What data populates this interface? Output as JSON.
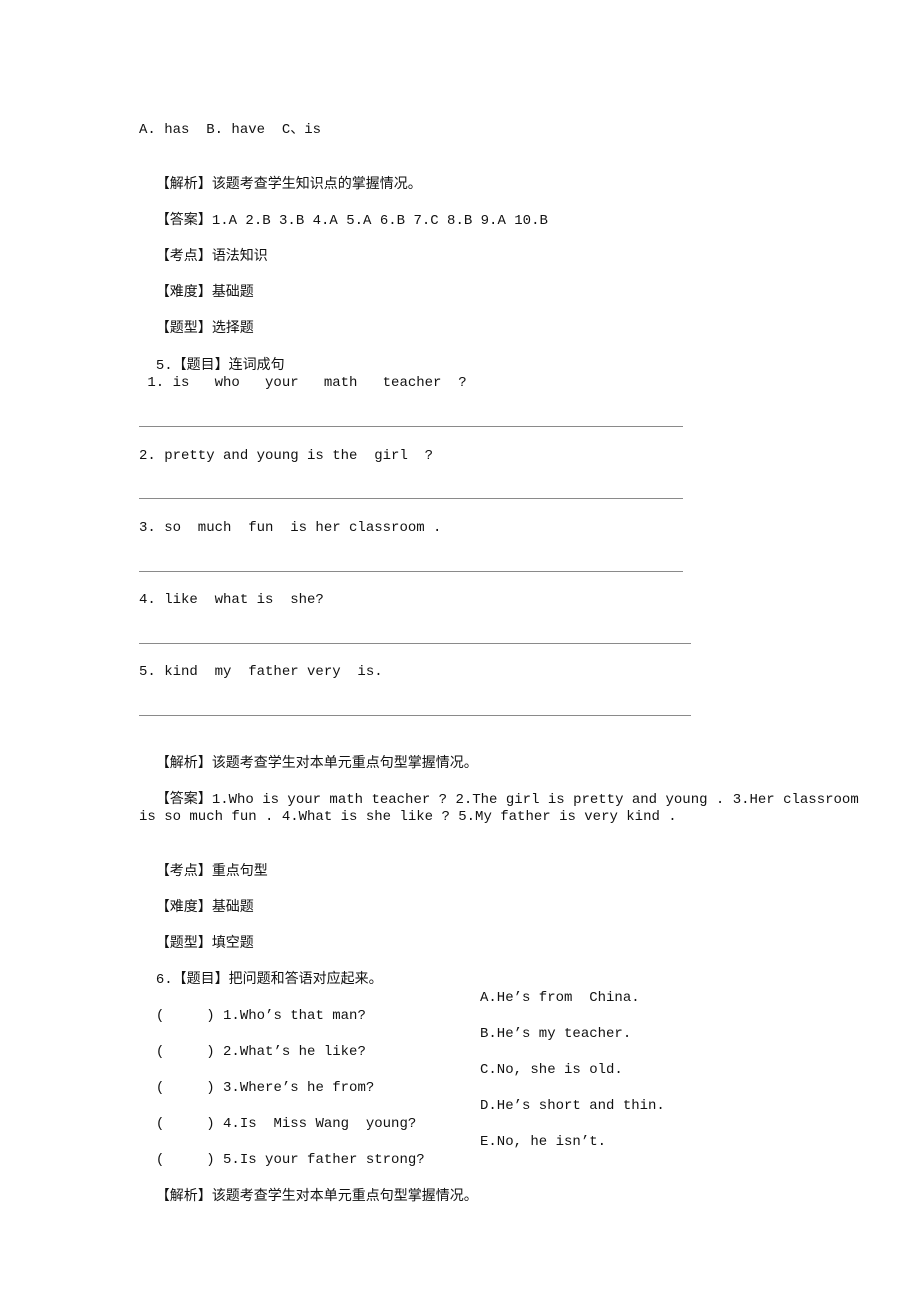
{
  "q4_tail": {
    "options": "A. has  B. have  C、is",
    "analysis_tag": "【解析】",
    "analysis": "该题考查学生知识点的掌握情况。",
    "answer_tag": "【答案】",
    "answer": "1.A 2.B 3.B 4.A 5.A 6.B 7.C 8.B 9.A 10.B",
    "point_tag": "【考点】",
    "point": "语法知识",
    "difficulty_tag": "【难度】",
    "difficulty": "基础题",
    "type_tag": "【题型】",
    "type": "选择题"
  },
  "q5": {
    "number": "5.",
    "title_tag": "【题目】",
    "title": "连词成句",
    "items": [
      " 1. is   who   your   math   teacher  ?",
      "2. pretty and young is the  girl  ?",
      "3. so  much  fun  is her classroom .",
      "4. like  what is  she?",
      "5. kind  my  father very  is."
    ],
    "analysis_tag": "【解析】",
    "analysis": "该题考查学生对本单元重点句型掌握情况。",
    "answer_tag": "【答案】",
    "answer_line1": "1.Who is your math teacher ? 2.The girl is pretty and young . 3.Her classroom",
    "answer_line2": "is so much fun . 4.What is she like ? 5.My father is very kind .",
    "point_tag": "【考点】",
    "point": "重点句型",
    "difficulty_tag": "【难度】",
    "difficulty": "基础题",
    "type_tag": "【题型】",
    "type": "填空题"
  },
  "q6": {
    "number": "6.",
    "title_tag": "【题目】",
    "title": "把问题和答语对应起来。",
    "rows": [
      {
        "blank": "(     )",
        "question": "1.Who’s that man?",
        "answer": "A.He’s from  China."
      },
      {
        "blank": "(     )",
        "question": "2.What’s he like?",
        "answer": "B.He’s my teacher."
      },
      {
        "blank": "(     )",
        "question": "3.Where’s he from?",
        "answer": "C.No, she is old."
      },
      {
        "blank": "(     )",
        "question": "4.Is  Miss Wang  young?",
        "answer": "D.He’s short and thin."
      },
      {
        "blank": "(     )",
        "question": "5.Is your father strong?",
        "answer": "E.No, he isn’t."
      }
    ],
    "analysis_tag": "【解析】",
    "analysis": "该题考查学生对本单元重点句型掌握情况。"
  }
}
